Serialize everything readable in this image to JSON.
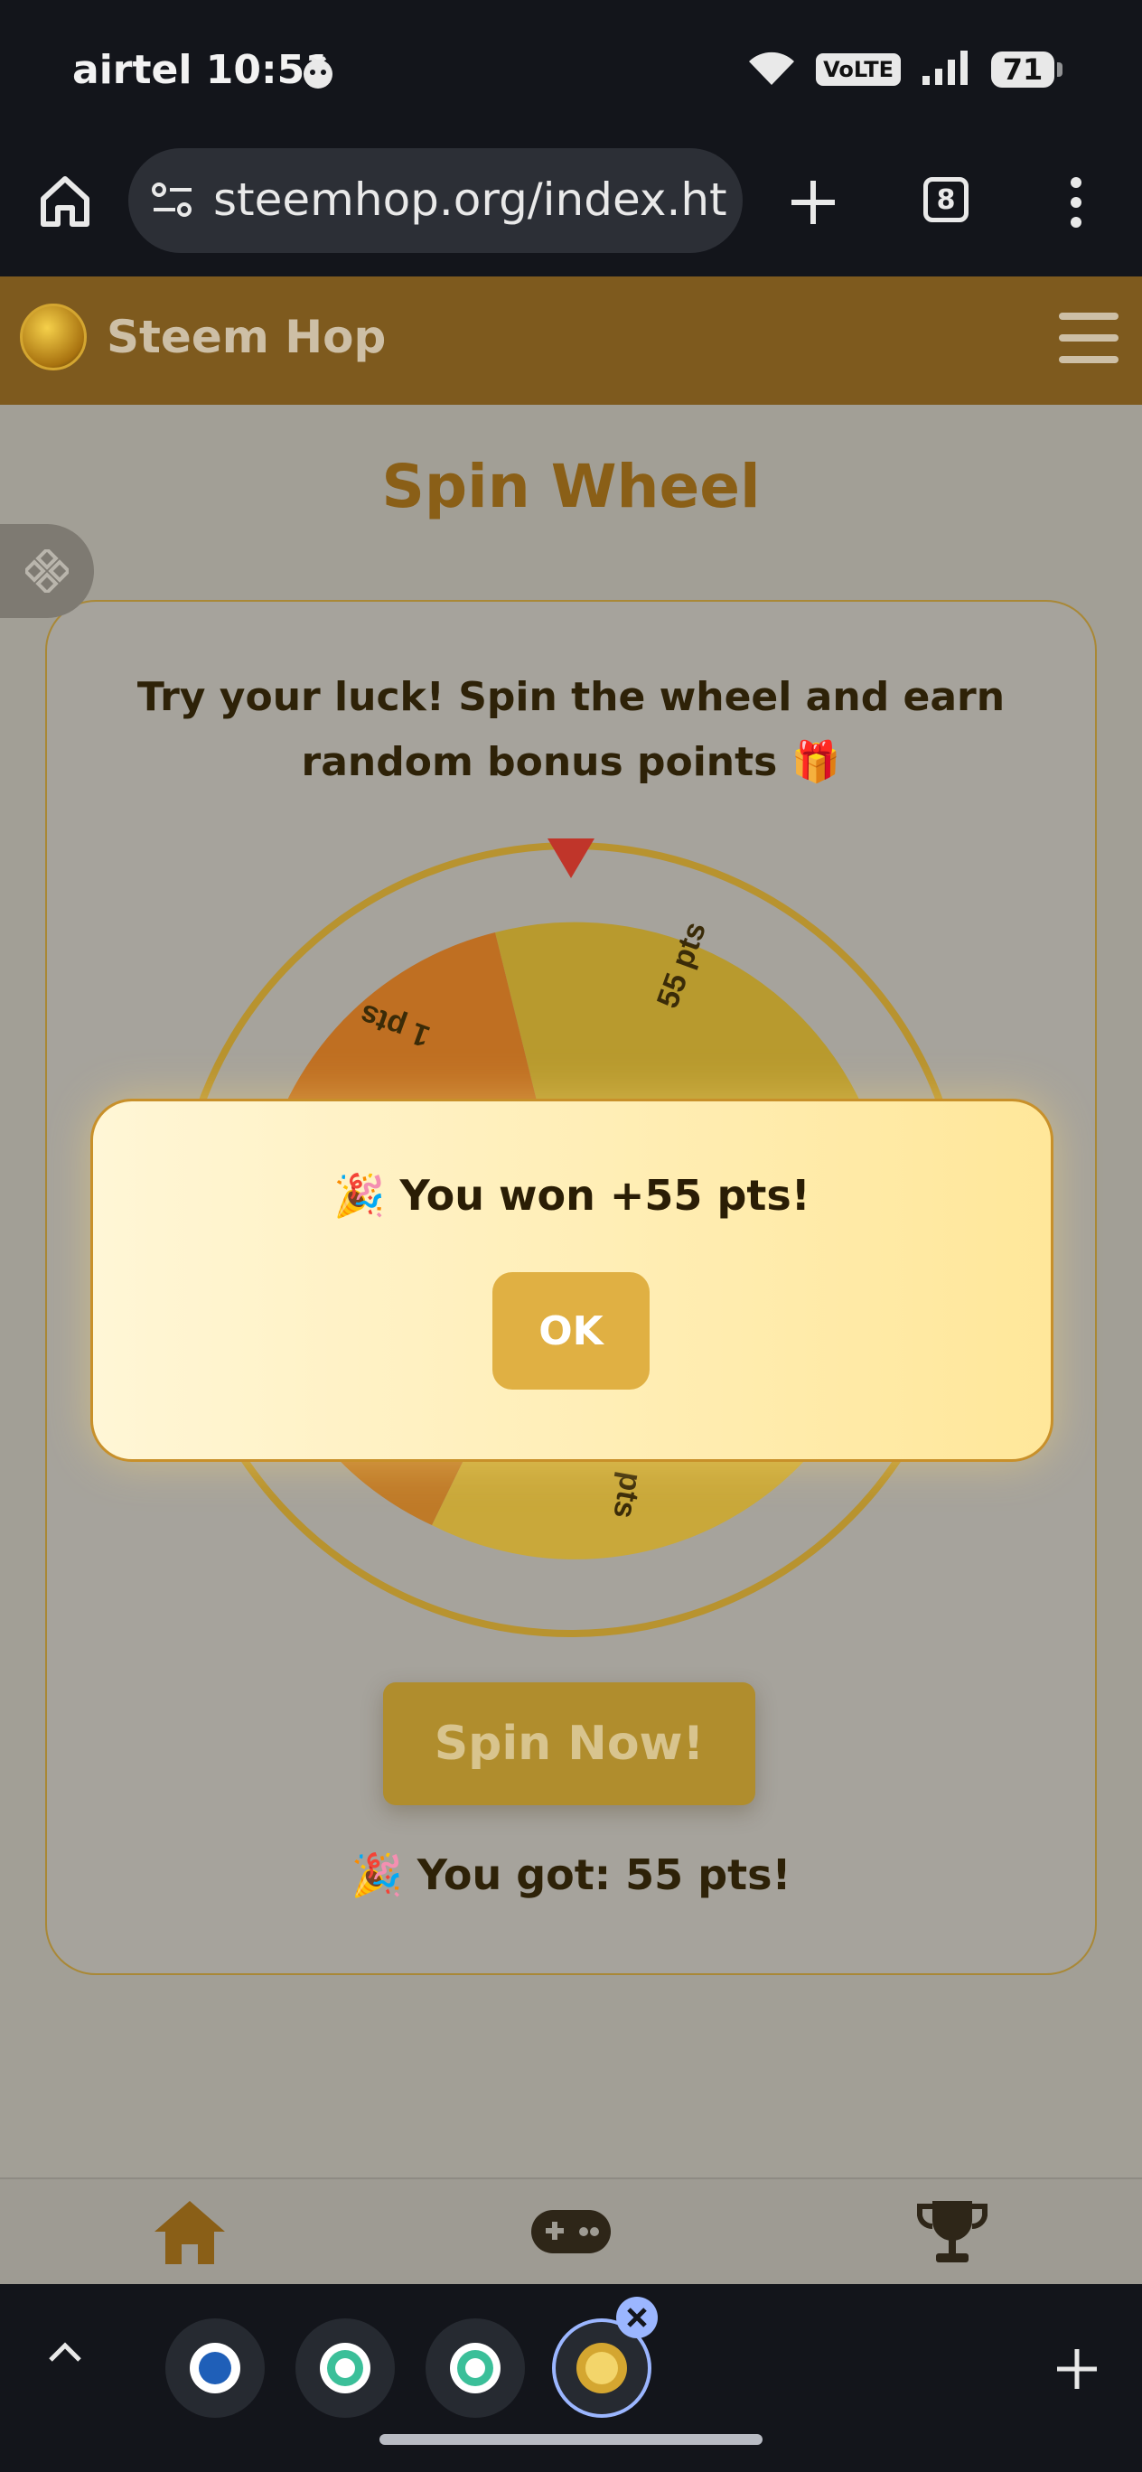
{
  "status_bar": {
    "carrier_time": "airtel 10:51",
    "network": "VoLTE",
    "battery": "71"
  },
  "browser": {
    "url": "steemhop.org/index.html",
    "tab_count": "8"
  },
  "app": {
    "title": "Steem Hop"
  },
  "page": {
    "title": "Spin Wheel",
    "intro": "Try your luck! Spin the wheel and earn random bonus points 🎁",
    "spin_button": "Spin Now!",
    "result": "🎉 You got: 55 pts!"
  },
  "wheel": {
    "segment_labels": [
      "55 pts",
      "1 pts",
      "pts"
    ],
    "colors": {
      "rim": "#b8932f",
      "slice_a": "#b89a2e",
      "slice_b": "#bf6f22",
      "slice_c": "#c9a83a",
      "pointer": "#c0352a"
    }
  },
  "modal": {
    "message": "🎉 You won +55 pts!",
    "ok_label": "OK"
  },
  "bottom_nav": {
    "items": [
      "home-icon",
      "gamepad-icon",
      "trophy-icon"
    ]
  },
  "colors": {
    "brand": "#7e5a1e",
    "accent": "#e0b043",
    "title": "#8a5f17"
  }
}
